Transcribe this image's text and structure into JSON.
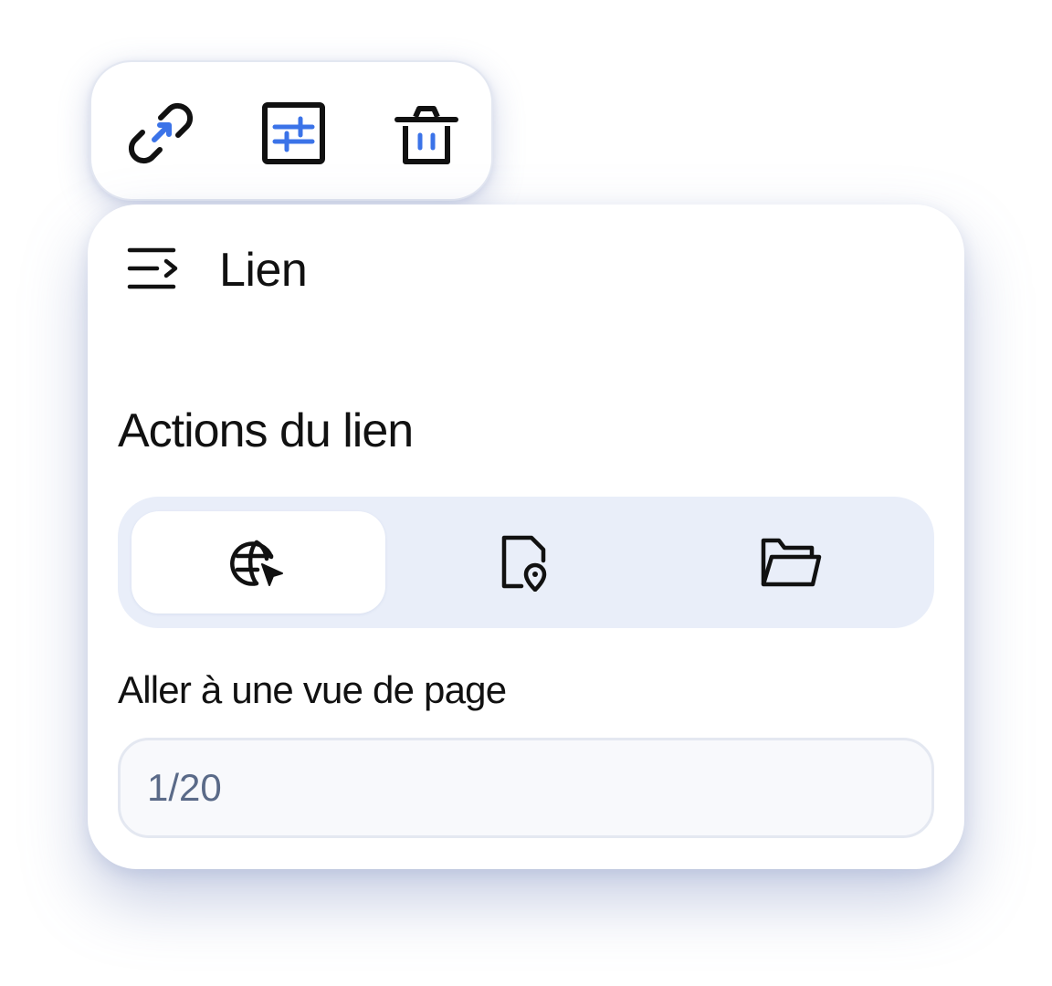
{
  "toolbar": {
    "link_button": {
      "icon": "link-arrow-icon"
    },
    "adjust_button": {
      "icon": "sliders-icon"
    },
    "delete_button": {
      "icon": "trash-icon"
    }
  },
  "panel": {
    "header_icon": "collapse-panel-icon",
    "title": "Lien",
    "section_title": "Actions du lien",
    "actions": [
      {
        "icon": "globe-cursor-icon",
        "selected": true
      },
      {
        "icon": "file-location-icon",
        "selected": false
      },
      {
        "icon": "folder-open-icon",
        "selected": false
      }
    ],
    "field_label": "Aller à une vue de page",
    "page_input": {
      "placeholder": "1/20"
    }
  },
  "colors": {
    "accent": "#3b73e8",
    "segment_bg": "#e9eef9",
    "text": "#111111",
    "placeholder": "#5a6a88"
  }
}
